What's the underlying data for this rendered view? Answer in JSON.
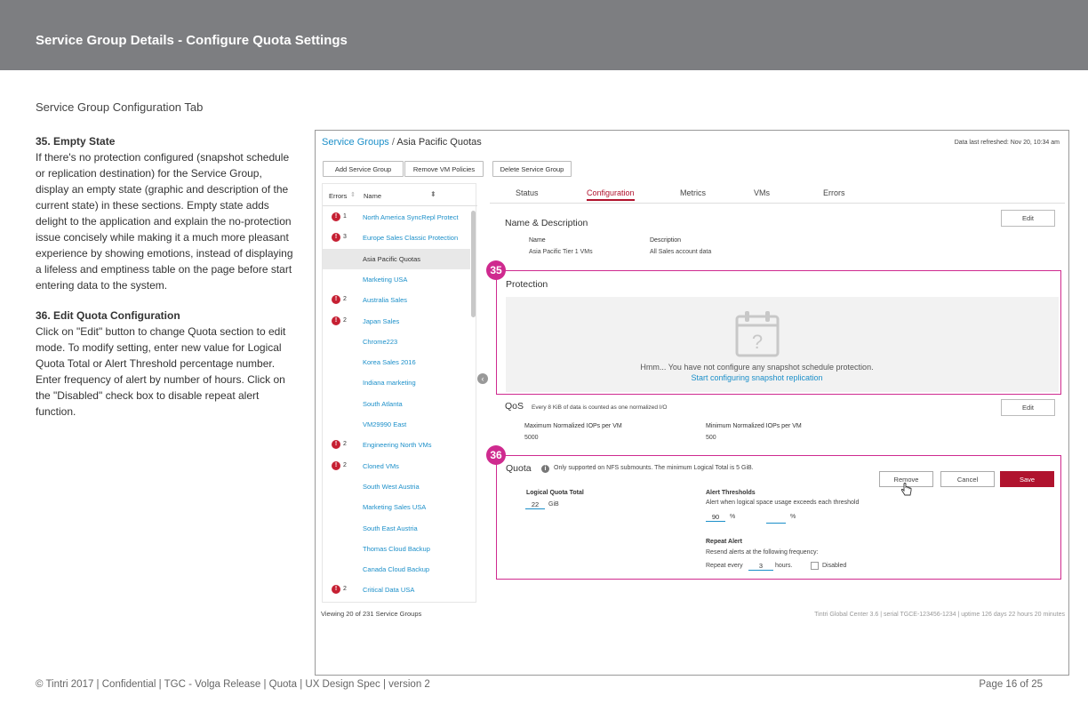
{
  "header": {
    "title": "Service Group Details - Configure Quota Settings"
  },
  "subtitle": "Service Group Configuration Tab",
  "notes": {
    "n35_title": "35. Empty State",
    "n35_body": "If there's no protection configured (snapshot schedule or replication destination) for the Service Group, display an empty state (graphic and description of the current state) in these sections. Empty state adds delight to the application and explain the no-protection issue concisely while making it a much more pleasant experience by showing emotions, instead of displaying a lifeless and emptiness table on the page before start entering data to the system.",
    "n36_title": "36. Edit Quota Configuration",
    "n36_body1": "Click on \"Edit\" button to change Quota section to edit mode. To modify setting, enter new value for Logical Quota Total or Alert Threshold percentage number.",
    "n36_body2": "Enter frequency of alert by number of hours. Click on the \"Disabled\" check box to disable repeat alert function."
  },
  "footer": {
    "left": "© Tintri 2017  | Confidential |  TGC - Volga Release  |  Quota  |  UX Design Spec  |  version 2",
    "right": "Page 16 of 25"
  },
  "app": {
    "breadcrumb_link": "Service Groups",
    "breadcrumb_sep": " / ",
    "breadcrumb_current": "Asia Pacific Quotas",
    "refreshed": "Data last refreshed: Nov 20, 10:34 am",
    "toolbar": {
      "add": "Add Service Group",
      "remove": "Remove VM Policies",
      "delete": "Delete Service Group"
    },
    "list": {
      "col_errors": "Errors",
      "col_name": "Name",
      "rows": [
        {
          "errors": "1",
          "name": "North America SyncRepl Protect"
        },
        {
          "errors": "3",
          "name": "Europe Sales Classic Protection"
        },
        {
          "errors": "",
          "name": "Asia Pacific Quotas"
        },
        {
          "errors": "",
          "name": "Marketing USA"
        },
        {
          "errors": "2",
          "name": "Australia Sales"
        },
        {
          "errors": "2",
          "name": "Japan Sales"
        },
        {
          "errors": "",
          "name": "Chrome223"
        },
        {
          "errors": "",
          "name": "Korea Sales 2016"
        },
        {
          "errors": "",
          "name": "Indiana marketing"
        },
        {
          "errors": "",
          "name": "South Atlanta"
        },
        {
          "errors": "",
          "name": "VM29990 East"
        },
        {
          "errors": "2",
          "name": "Engineering North VMs"
        },
        {
          "errors": "2",
          "name": "Cloned VMs"
        },
        {
          "errors": "",
          "name": "South West Austria"
        },
        {
          "errors": "",
          "name": "Marketing Sales USA"
        },
        {
          "errors": "",
          "name": "South East Austria"
        },
        {
          "errors": "",
          "name": "Thomas Cloud Backup"
        },
        {
          "errors": "",
          "name": "Canada Cloud Backup"
        },
        {
          "errors": "2",
          "name": "Critical Data USA"
        }
      ],
      "footer": "Viewing 20 of 231 Service Groups"
    },
    "tabs": [
      "Status",
      "Configuration",
      "Metrics",
      "VMs",
      "Errors"
    ],
    "name_desc": {
      "title": "Name & Description",
      "edit": "Edit",
      "name_label": "Name",
      "name_value": "Asia Pacific Tier 1 VMs",
      "desc_label": "Description",
      "desc_value": "All Sales account data"
    },
    "protection": {
      "badge": "35",
      "title": "Protection",
      "icon_text": "?",
      "message": "Hmm... You have not configure any snapshot schedule protection.",
      "cta": "Start configuring snapshot replication"
    },
    "qos": {
      "title": "QoS",
      "note": "Every 8 KiB of data is counted as one normalized I/O",
      "edit": "Edit",
      "max_label": "Maximum Normalized IOPs per VM",
      "max_value": "5000",
      "min_label": "Minimum Normalized IOPs per VM",
      "min_value": "500"
    },
    "quota": {
      "badge": "36",
      "title": "Quota",
      "info": "Only supported on NFS submounts. The minimum Logical Total is 5 GiB.",
      "remove": "Remove",
      "cancel": "Cancel",
      "save": "Save",
      "total_label": "Logical Quota Total",
      "total_value": "22",
      "total_unit": "GiB",
      "alert_label": "Alert Thresholds",
      "alert_desc": "Alert when logical space usage exceeds each threshold",
      "alert_value1": "90",
      "alert_unit1": "%",
      "alert_value2": "",
      "alert_unit2": "%",
      "repeat_label": "Repeat Alert",
      "repeat_desc": "Resend alerts at the following frequency:",
      "repeat_prefix": "Repeat every",
      "repeat_value": "3",
      "repeat_unit": "hours.",
      "disabled_label": "Disabled"
    },
    "statusbar": "Tintri Global Center 3.6   |   serial TGCE-123456-1234   |   uptime 126 days 22 hours 20 minutes"
  },
  "colors": {
    "header_bg": "#7d7e81",
    "accent": "#b0132e",
    "link": "#1b8fc9",
    "annotation": "#cf2a8f",
    "error": "#c62033"
  }
}
